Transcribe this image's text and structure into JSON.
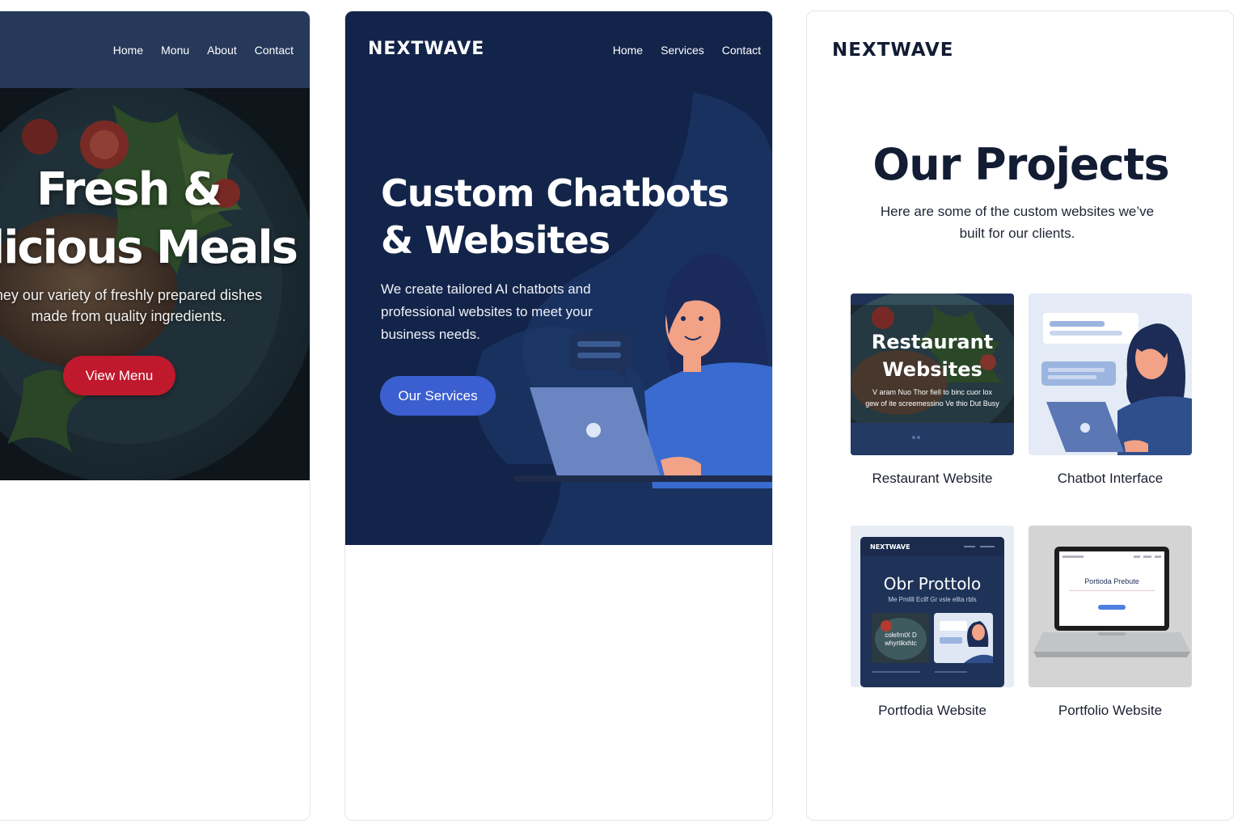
{
  "restaurant_panel": {
    "nav": [
      "Home",
      "Monu",
      "About",
      "Contact"
    ],
    "hero_title_line1": "Fresh &",
    "hero_title_line2": "elicious Meals",
    "hero_subtitle_line1": "ney our variety of freshly prepared dishes",
    "hero_subtitle_line2": "made from quality ingredients.",
    "cta_label": "View Menu",
    "colors": {
      "nav": "#26395a",
      "cta": "#c0182d"
    }
  },
  "chatbot_panel": {
    "logo": "NEXTWAVE",
    "nav": [
      "Home",
      "Services",
      "Contact"
    ],
    "hero_title_line1": "Custom Chatbots",
    "hero_title_line2": "& Websites",
    "hero_subtitle": "We create tailored AI chatbots and professional websites to meet your business needs.",
    "cta_label": "Our Services",
    "colors": {
      "background": "#13244a",
      "cta": "#3b5fd0",
      "shirt": "#3a6bd0"
    }
  },
  "projects_panel": {
    "logo": "NEXTWAVE",
    "title": "Our Projects",
    "subtitle": "Here are some of the custom websites we’ve built for our clients.",
    "projects": [
      {
        "caption": "Restaurant Website",
        "thumb_title_line1": "Restaurant",
        "thumb_title_line2": "Websites",
        "thumb_body_line1": "V aram Nuo  Thor fiell to binc cuor lox",
        "thumb_body_line2": "gew of ite screemessino  Ve thio Dut Busy",
        "icon": "restaurant-thumb"
      },
      {
        "caption": "Chatbot Interface",
        "icon": "chatbot-thumb"
      },
      {
        "caption": "Portfodia Website",
        "thumb_logo": "NEXTWAVE",
        "thumb_title": "Obr Prottolo",
        "thumb_sub": "Me Pmllll Ecllf Gr vsle ellta rbls",
        "thumb_card_text": "colefrntX D whyrtikxhtc",
        "icon": "portfolio-thumb"
      },
      {
        "caption": "Portfolio Website",
        "thumb_screen_title": "Portioda Prebute",
        "icon": "laptop-thumb"
      }
    ],
    "colors": {
      "title": "#121c33",
      "thumb_navy": "#1f3358"
    }
  }
}
